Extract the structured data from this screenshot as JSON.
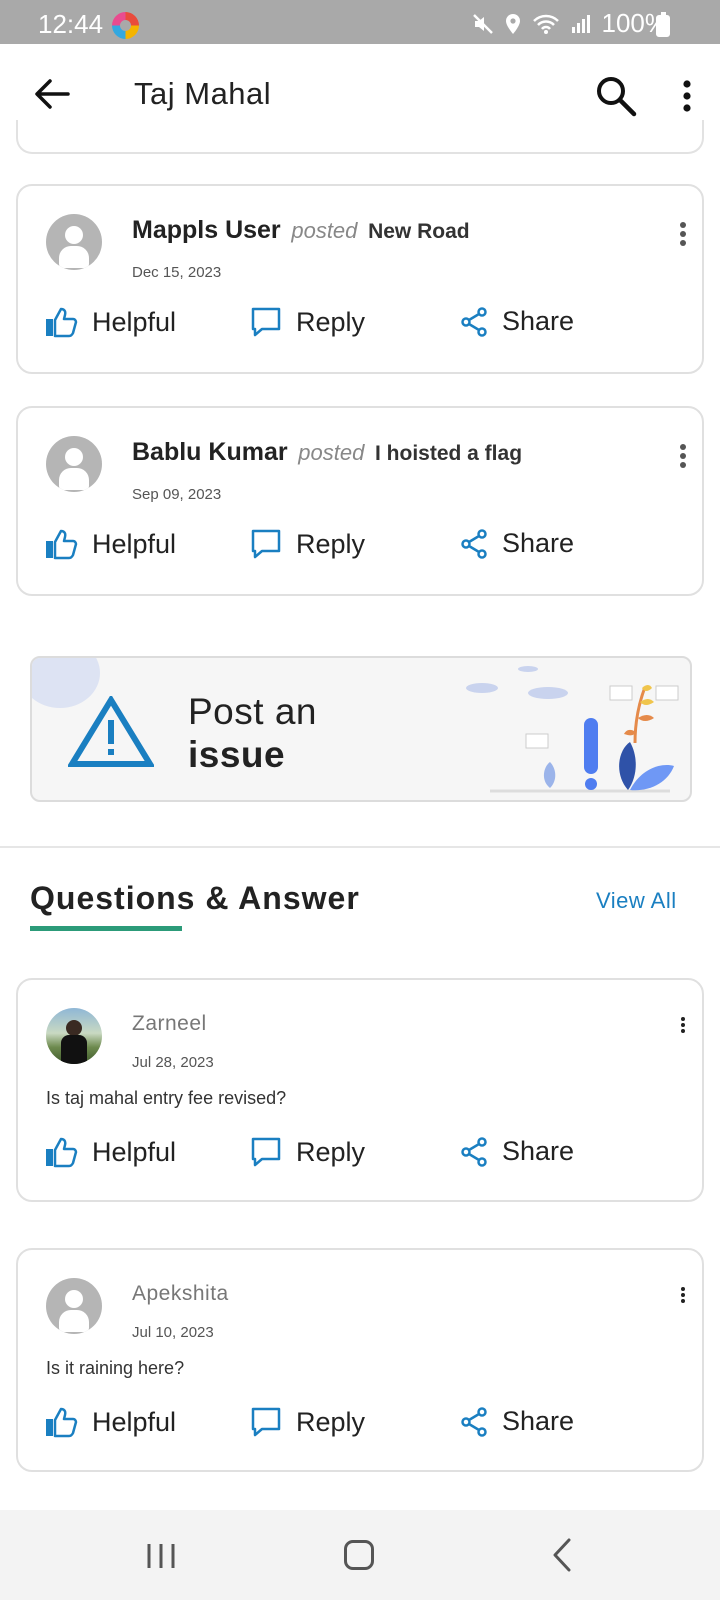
{
  "status_bar": {
    "time": "12:44",
    "battery": "100%"
  },
  "app_bar": {
    "title": "Taj Mahal"
  },
  "posts": [
    {
      "user": "Mappls User",
      "verb": "posted",
      "object": "New Road",
      "date": "Dec 15, 2023"
    },
    {
      "user": "Bablu Kumar",
      "verb": "posted",
      "object": "I hoisted a flag",
      "date": "Sep 09, 2023"
    }
  ],
  "actions": {
    "helpful": "Helpful",
    "reply": "Reply",
    "share": "Share"
  },
  "issue_banner": {
    "line1": "Post an",
    "line2": "issue"
  },
  "qa_section": {
    "heading": "Questions & Answer",
    "view_all": "View All",
    "items": [
      {
        "user": "Zarneel",
        "date": "Jul 28, 2023",
        "question": "Is taj mahal entry fee revised?"
      },
      {
        "user": "Apekshita",
        "date": "Jul 10, 2023",
        "question": "Is it raining here?"
      }
    ]
  },
  "colors": {
    "accent_blue": "#1a7fc1",
    "underline_green": "#2c9b79",
    "warning_blue": "#1a7fc1",
    "status_bar_gray": "#a9a9a9"
  }
}
